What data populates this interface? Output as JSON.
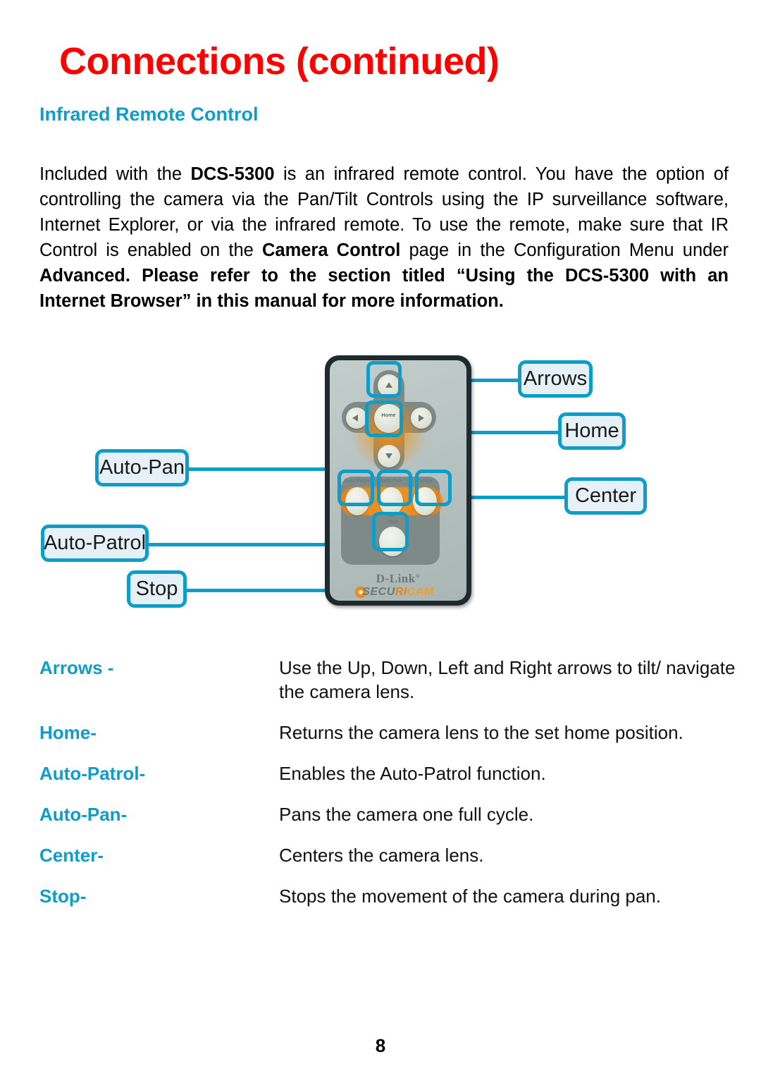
{
  "document": {
    "page_title": "Connections (continued)",
    "section_title": "Infrared Remote Control",
    "page_number": "8"
  },
  "intro": {
    "part1": "Included with the ",
    "bold1": "DCS-5300",
    "part2": " is an infrared remote control. You have the option of controlling the camera via the Pan/Tilt Controls using the IP surveillance software, Internet Explorer, or via the infrared remote. To use the remote, make sure that IR Control is enabled on the ",
    "bold2": "Camera Control",
    "part3": " page in the Configuration Menu under ",
    "bold3": "Advanced",
    "bold4": ". Please refer to the section titled “Using the DCS-5300 with an Internet Browser”  in this manual for more information."
  },
  "figure": {
    "callouts": {
      "arrows": "Arrows",
      "home": "Home",
      "center": "Center",
      "auto_pan": "Auto-Pan",
      "auto_patrol": "Auto-Patrol",
      "stop": "Stop"
    },
    "remote": {
      "home_button_label": "Home",
      "auto_patrol_button_label": "Auto-Patrol",
      "auto_pan_button_label": "Auto-Pan",
      "center_button_label": "Center",
      "stop_button_label": "Stop",
      "brand_name": "D-Link",
      "brand_trademark": "®",
      "brand_sub_secu": "SECU",
      "brand_sub_ri": "RI",
      "brand_sub_cam": "CAM"
    }
  },
  "definitions": [
    {
      "term": "Arrows -",
      "desc": "Use the Up, Down, Left and Right arrows to tilt/ navigate the camera lens."
    },
    {
      "term": "Home-",
      "desc": "Returns the camera lens to the set home position."
    },
    {
      "term": "Auto-Patrol-",
      "desc": "Enables the Auto-Patrol function."
    },
    {
      "term": "Auto-Pan-",
      "desc": "Pans the camera one full cycle."
    },
    {
      "term": "Center-",
      "desc": "Centers the camera lens."
    },
    {
      "term": "Stop-",
      "desc": "Stops the movement of the camera during pan."
    }
  ],
  "colors": {
    "title_red": "#ff0000",
    "accent_cyan": "#0e9dc9",
    "callout_fill": "#e6f1f7",
    "body_text": "#111111"
  }
}
